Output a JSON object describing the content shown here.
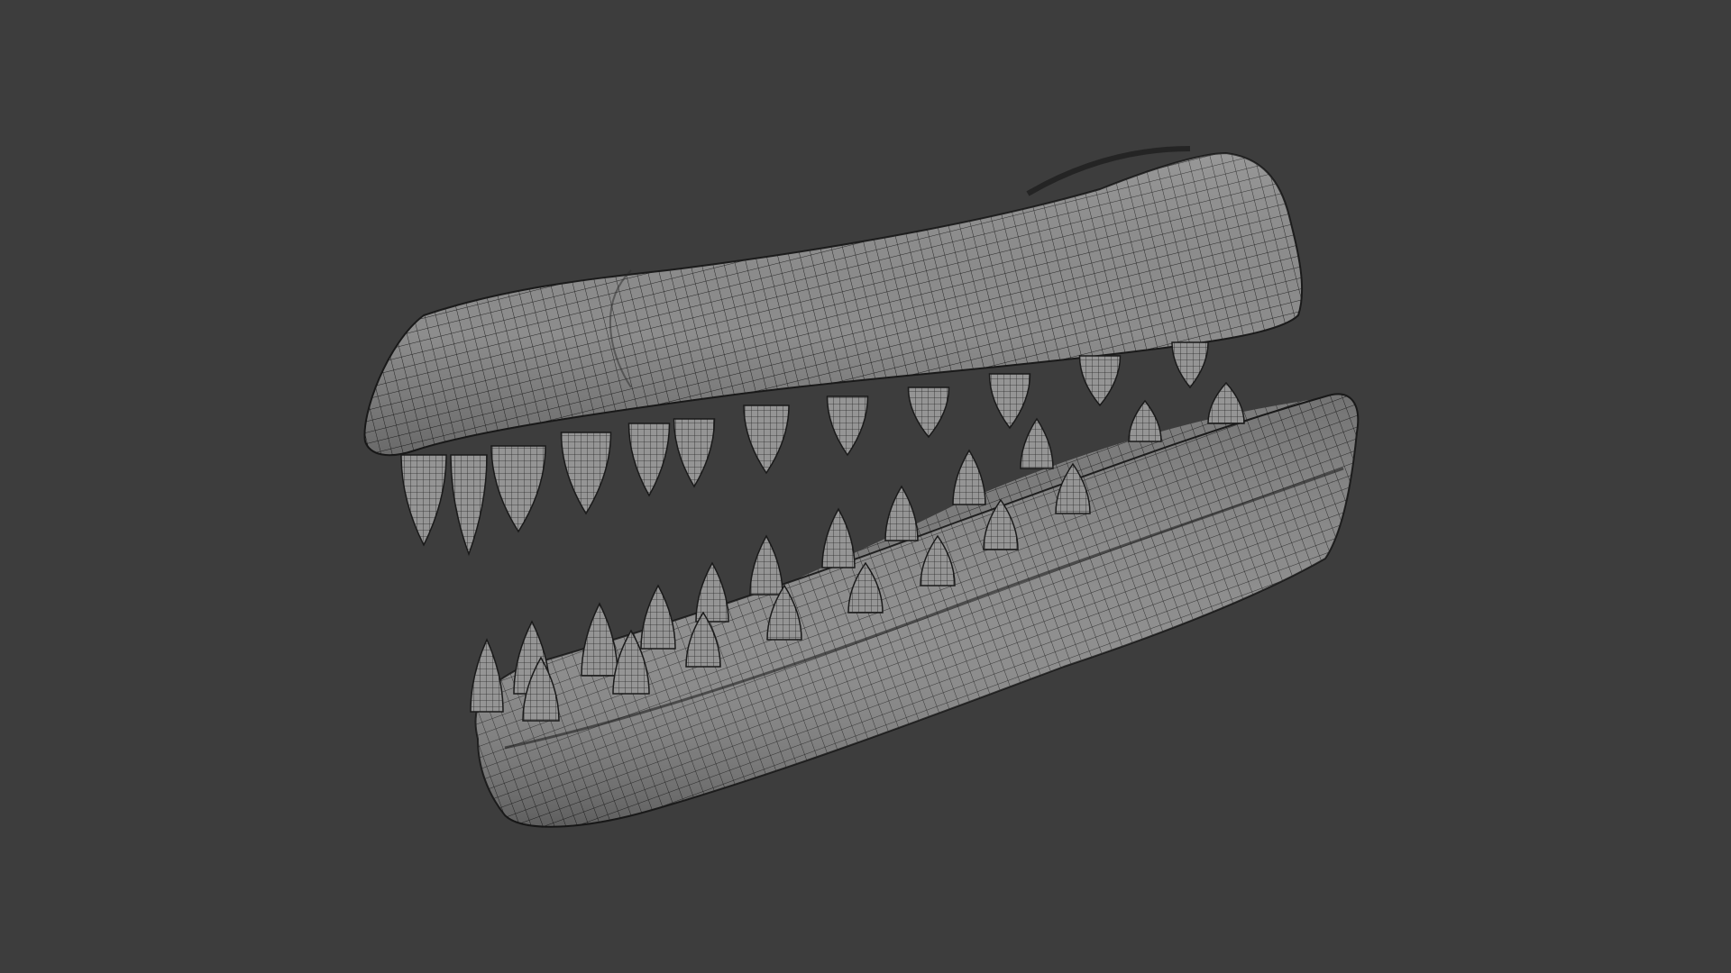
{
  "viewport": {
    "background_color": "#3d3d3d"
  },
  "model": {
    "name": "crocodile-jaw-wireframe-model",
    "surface_color": "#8a8a8a",
    "wire_color": "#1e1e1e",
    "shading": "wireframe-on-shaded",
    "parts": [
      "upper-jaw",
      "lower-jaw",
      "upper-teeth",
      "lower-teeth"
    ]
  }
}
